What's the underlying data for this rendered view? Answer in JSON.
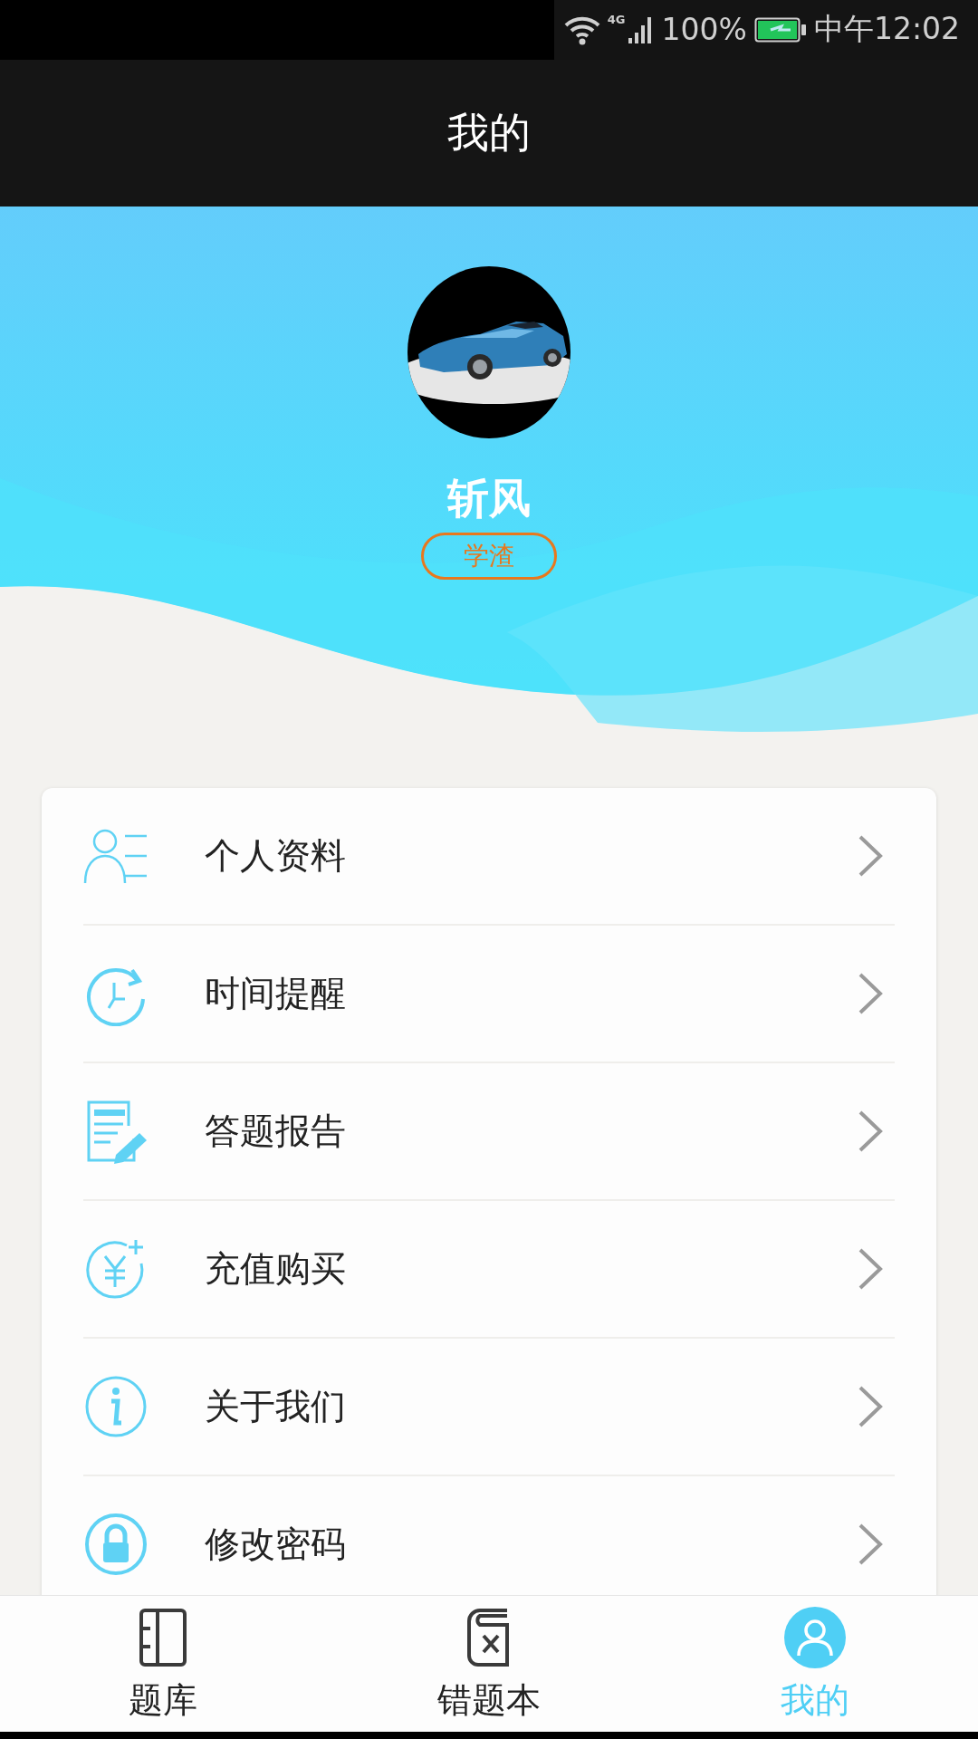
{
  "status_bar": {
    "network": "4G",
    "battery": "100%",
    "time": "中午12:02"
  },
  "title": "我的",
  "profile": {
    "name": "斩风",
    "badge": "学渣"
  },
  "menu": [
    {
      "label": "个人资料",
      "kind": "profile"
    },
    {
      "label": "时间提醒",
      "kind": "clock"
    },
    {
      "label": "答题报告",
      "kind": "report"
    },
    {
      "label": "充值购买",
      "kind": "recharge"
    },
    {
      "label": "关于我们",
      "kind": "info"
    },
    {
      "label": "修改密码",
      "kind": "lock"
    }
  ],
  "tabs": [
    {
      "label": "题库",
      "kind": "book",
      "selected": false
    },
    {
      "label": "错题本",
      "kind": "wrongbook",
      "selected": false
    },
    {
      "label": "我的",
      "kind": "person",
      "selected": true
    }
  ]
}
